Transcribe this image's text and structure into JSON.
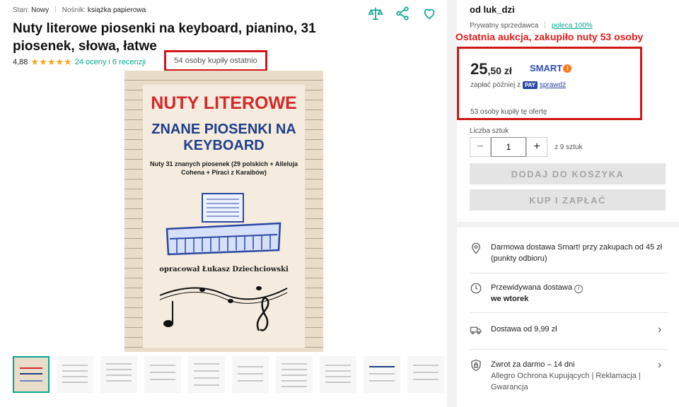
{
  "product": {
    "condition_label": "Stan:",
    "condition_value": "Nowy",
    "medium_label": "Nośnik:",
    "medium_value": "książka papierowa",
    "title": "Nuty literowe piosenki na keyboard, pianino, 31 piosenek, słowa, łatwe",
    "rating_value": "4,88",
    "stars": "★★★★★",
    "reviews_text": "24 oceny i 6 recenzji",
    "bought_recently": "54 osoby kupiły ostatnio"
  },
  "cover": {
    "line1": "NUTY LITEROWE",
    "line2": "ZNANE PIOSENKI NA KEYBOARD",
    "line3": "Nuty 31 znanych piosenek (29 polskich + Alleluja Cohena + Piraci z Karaibów)",
    "line4": "opracował Łukasz Dziechciowski"
  },
  "seller": {
    "name": "od luk_dzi",
    "type": "Prywatny sprzedawca",
    "recommend": "poleca 100%"
  },
  "annotation": "Ostatnia aukcja, zakupiło nuty 53 osoby",
  "offer": {
    "price_main": "25",
    "price_cents": ",50 zł",
    "smart_label": "SMART",
    "smart_mark": "!",
    "pay_later_text": "zapłać później z",
    "pay_badge": "PAY",
    "pay_link": "sprawdź",
    "bought_offer": "53 osoby kupiły tę ofertę",
    "quantity_label": "Liczba sztuk",
    "quantity_value": "1",
    "quantity_of": "z 9 sztuk",
    "add_to_cart": "DODAJ DO KOSZYKA",
    "buy_now": "KUP I ZAPŁAĆ"
  },
  "delivery": {
    "free_smart": "Darmowa dostawa Smart! przy zakupach od 45 zł (punkty odbioru)",
    "expected_label": "Przewidywana dostawa",
    "expected_value": "we wtorek",
    "cost": "Dostawa od 9,99 zł",
    "returns_line1": "Zwrot za darmo – 14 dni",
    "returns_line2": "Allegro Ochrona Kupujących | Reklamacja | Gwarancja"
  },
  "colors": {
    "accent": "#00a790",
    "annotation_red": "#d01616",
    "smart_blue": "#2f4fb3"
  }
}
